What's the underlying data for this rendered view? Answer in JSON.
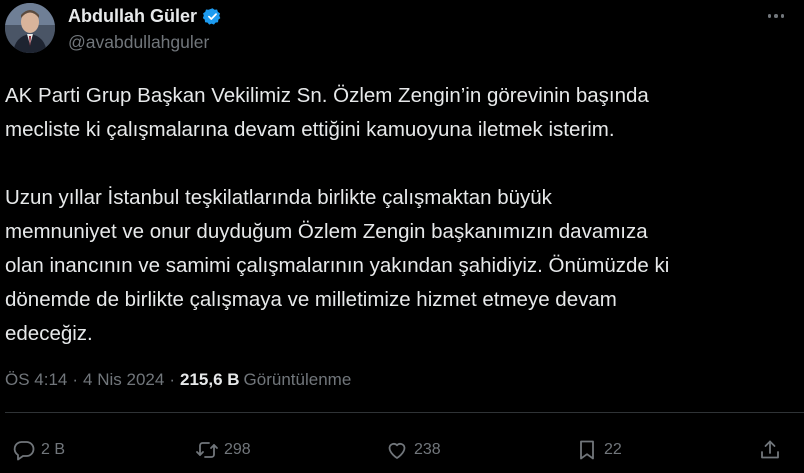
{
  "author": {
    "display_name": "Abdullah Güler",
    "handle": "@avabdullahguler",
    "verified": true
  },
  "tweet": {
    "paragraph_1": "AK Parti Grup Başkan Vekilimiz Sn. Özlem Zengin’in görevinin başında\nmecliste ki çalışmalarına devam ettiğini kamuoyuna iletmek isterim.",
    "paragraph_2": "Uzun yıllar İstanbul teşkilatlarında birlikte çalışmaktan büyük\nmemnuniyet ve onur duyduğum Özlem Zengin başkanımızın davamıza\nolan inancının ve samimi çalışmalarının yakından şahidiyiz. Önümüzde ki\ndönemde de birlikte çalışmaya ve milletimize hizmet etmeye devam\nedeceğiz."
  },
  "meta": {
    "time": "ÖS 4:14",
    "separator": "·",
    "date": "4 Nis 2024",
    "views_count": "215,6 B",
    "views_label": "Görüntülenme"
  },
  "actions": {
    "replies": "2 B",
    "reposts": "298",
    "likes": "238",
    "bookmarks": "22"
  },
  "colors": {
    "background": "#000000",
    "text": "#e7e9ea",
    "secondary": "#71767b",
    "divider": "#2f3336",
    "verified_badge": "#1d9bf0"
  },
  "icons": {
    "more": "more-dots-icon",
    "reply": "reply-bubble-icon",
    "repost": "repost-arrows-icon",
    "like": "heart-icon",
    "bookmark": "bookmark-icon",
    "share": "share-upload-icon",
    "verified": "verified-badge-icon"
  }
}
